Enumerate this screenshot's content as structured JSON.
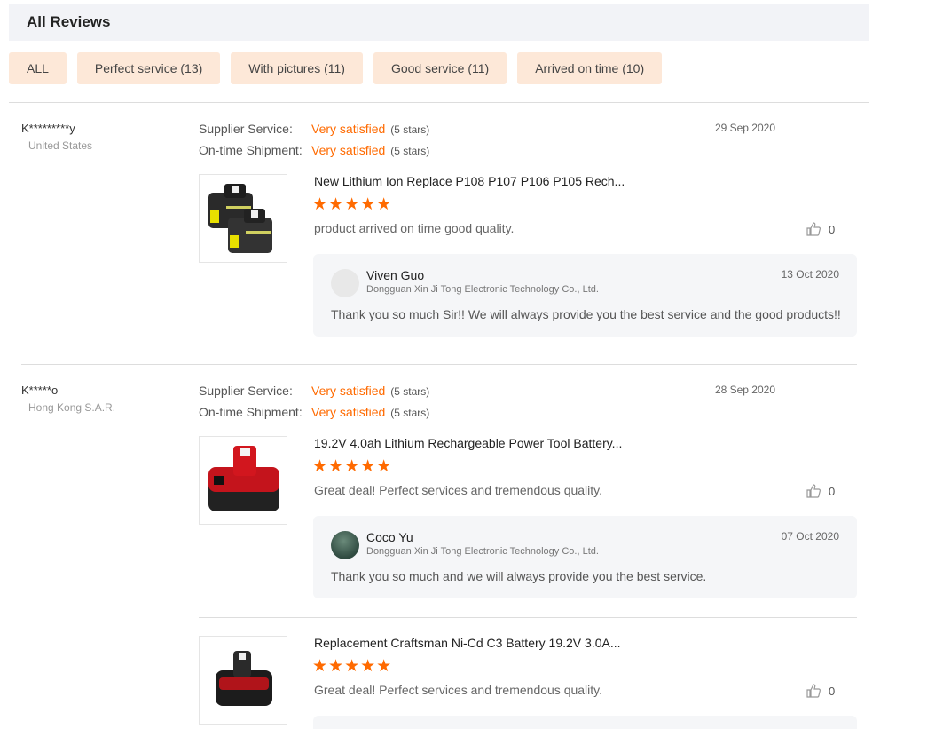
{
  "header": {
    "title": "All Reviews"
  },
  "filters": [
    {
      "label": "ALL"
    },
    {
      "label": "Perfect service (13)"
    },
    {
      "label": "With pictures (11)"
    },
    {
      "label": "Good service (11)"
    },
    {
      "label": "Arrived on time (10)"
    }
  ],
  "reviews": [
    {
      "user": "K*********y",
      "country": "United States",
      "supplier_label": "Supplier Service:",
      "supplier_value": "Very satisfied",
      "supplier_stars": "(5 stars)",
      "shipment_label": "On-time Shipment:",
      "shipment_value": "Very satisfied",
      "shipment_stars": "(5 stars)",
      "date": "29 Sep 2020",
      "product": "New Lithium Ion Replace P108 P107 P106 P105 Rech...",
      "rating": 5,
      "stars_text": "★★★★★",
      "text": "product arrived on time good quality.",
      "likes": "0",
      "reply": {
        "name": "Viven Guo",
        "company": "Dongguan Xin Ji Tong Electronic Technology Co., Ltd.",
        "date": "13 Oct 2020",
        "message": "Thank you so much Sir!! We will always provide you the best service and the good products!!"
      }
    },
    {
      "user": "K*****o",
      "country": "Hong Kong S.A.R.",
      "supplier_label": "Supplier Service:",
      "supplier_value": "Very satisfied",
      "supplier_stars": "(5 stars)",
      "shipment_label": "On-time Shipment:",
      "shipment_value": "Very satisfied",
      "shipment_stars": "(5 stars)",
      "date": "28 Sep 2020",
      "product": "19.2V 4.0ah Lithium Rechargeable Power Tool Battery...",
      "rating": 5,
      "stars_text": "★★★★★",
      "text": "Great deal! Perfect services and tremendous quality.",
      "likes": "0",
      "reply": {
        "name": "Coco Yu",
        "company": "Dongguan Xin Ji Tong Electronic Technology Co., Ltd.",
        "date": "07 Oct 2020",
        "message": "Thank you so much and we will always provide you the best service."
      }
    },
    {
      "product": "Replacement Craftsman Ni-Cd C3 Battery 19.2V 3.0A...",
      "rating": 5,
      "stars_text": "★★★★★",
      "text": "Great deal! Perfect services and tremendous quality.",
      "likes": "0"
    }
  ],
  "colors": {
    "accent": "#ff6a00",
    "chip_bg": "#fde8d8",
    "header_bg": "#f2f3f7",
    "reply_bg": "#f5f6f8"
  },
  "icons": {
    "like": "thumbs-up-icon"
  }
}
